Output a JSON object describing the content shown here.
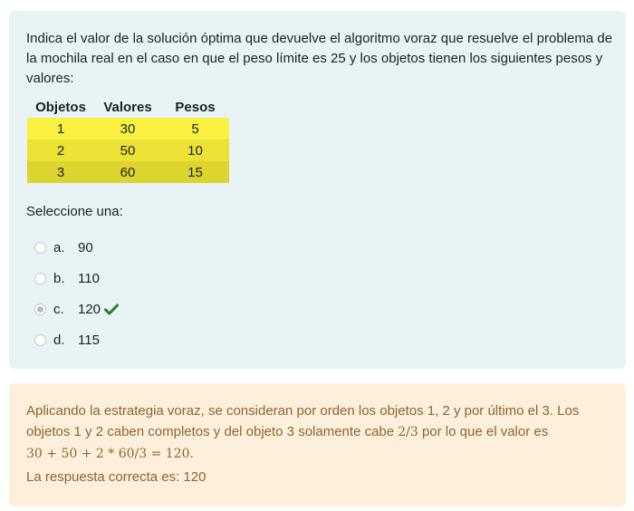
{
  "question": {
    "text": "Indica el valor de la solución óptima que devuelve el algoritmo voraz que resuelve el problema de la mochila real en el caso en que el peso límite es 25 y los objetos tienen los siguientes pesos y valores:",
    "table": {
      "headers": [
        "Objetos",
        "Valores",
        "Pesos"
      ],
      "rows": [
        [
          "1",
          "30",
          "5"
        ],
        [
          "2",
          "50",
          "10"
        ],
        [
          "3",
          "60",
          "15"
        ]
      ],
      "row_colors": [
        "#f9f03f",
        "#ece235",
        "#ded42f"
      ]
    },
    "prompt": "Seleccione una:",
    "answers": [
      {
        "letter": "a.",
        "value": "90",
        "selected": false,
        "correct": false
      },
      {
        "letter": "b.",
        "value": "110",
        "selected": false,
        "correct": false
      },
      {
        "letter": "c.",
        "value": "120",
        "selected": true,
        "correct": true,
        "icon": "check-icon"
      },
      {
        "letter": "d.",
        "value": "115",
        "selected": false,
        "correct": false
      }
    ]
  },
  "feedback": {
    "explanation_part1": "Aplicando la estrategia voraz, se consideran por orden los objetos 1, 2 y por último el 3. Los objetos 1 y 2 caben completos y del objeto 3 solamente cabe ",
    "fraction": "2/3",
    "explanation_part2": " por lo que el valor es ",
    "formula": "30 + 50 + 2 * 60/3 = 120",
    "explanation_end": ".",
    "correct_answer": "La respuesta correcta es: 120"
  },
  "colors": {
    "question_bg": "#e7f3f5",
    "feedback_bg": "#fcefdc",
    "feedback_text": "#8e662e",
    "check": "#2e7d32"
  }
}
